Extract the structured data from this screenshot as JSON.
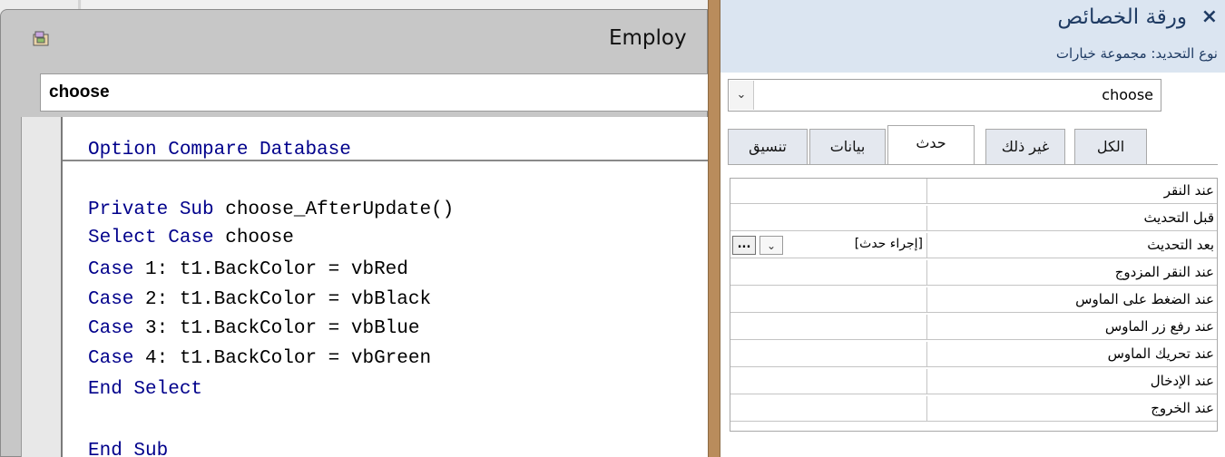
{
  "code_window": {
    "title": "Employ",
    "object_combo": "choose",
    "lines": [
      {
        "kw": "Option Compare Database",
        "rest": ""
      },
      {
        "kw": "",
        "rest": ""
      },
      {
        "kw": "Private Sub",
        "rest": " choose_AfterUpdate()"
      },
      {
        "kw": "Select Case",
        "rest": " choose"
      },
      {
        "kw": "Case",
        "rest": " 1: t1.BackColor = vbRed"
      },
      {
        "kw": "Case",
        "rest": " 2: t1.BackColor = vbBlack"
      },
      {
        "kw": "Case",
        "rest": " 3: t1.BackColor = vbBlue"
      },
      {
        "kw": "Case",
        "rest": " 4: t1.BackColor = vbGreen"
      },
      {
        "kw": "End Select",
        "rest": ""
      },
      {
        "kw": "",
        "rest": ""
      },
      {
        "kw": "End Sub",
        "rest": ""
      }
    ]
  },
  "property_sheet": {
    "title": "ورقة الخصائص",
    "close_icon": "×",
    "selection_type_label": "نوع التحديد:",
    "selection_type_value": "مجموعة خيارات",
    "control_combo_value": "choose",
    "dropdown_glyph": "⌄",
    "tabs": [
      "تنسيق",
      "بيانات",
      "حدث",
      "غير ذلك",
      "الكل"
    ],
    "active_tab": "حدث",
    "events": [
      {
        "name": "عند النقر",
        "value": ""
      },
      {
        "name": "قبل التحديث",
        "value": ""
      },
      {
        "name": "بعد التحديث",
        "value": "[إجراء حدث]"
      },
      {
        "name": "عند النقر المزدوج",
        "value": ""
      },
      {
        "name": "عند الضغط على الماوس",
        "value": ""
      },
      {
        "name": "عند رفع زر الماوس",
        "value": ""
      },
      {
        "name": "عند تحريك الماوس",
        "value": ""
      },
      {
        "name": "عند الإدخال",
        "value": ""
      },
      {
        "name": "عند الخروج",
        "value": ""
      }
    ],
    "build_button_label": "..."
  },
  "colors": {
    "keyword": "#00008b",
    "header_bg": "#dbe5f1",
    "title_text": "#1f3b63",
    "divider": "#b98c5c"
  }
}
